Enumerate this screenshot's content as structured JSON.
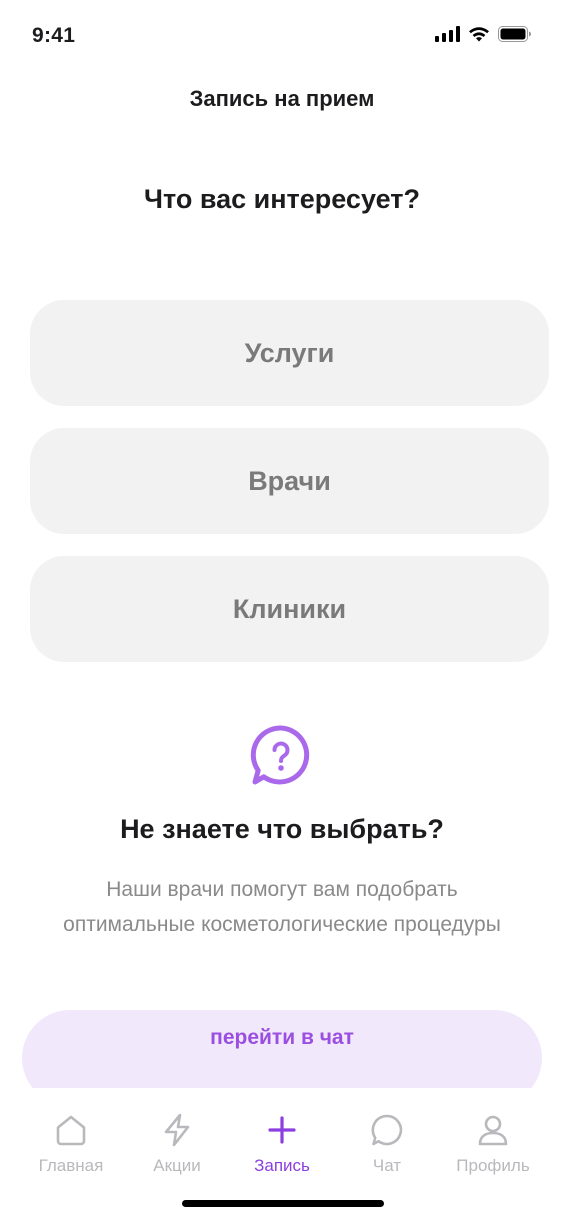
{
  "status_bar": {
    "time": "9:41"
  },
  "header": {
    "title": "Запись на прием"
  },
  "main": {
    "question": "Что вас интересует?",
    "options": [
      {
        "label": "Услуги"
      },
      {
        "label": "Врачи"
      },
      {
        "label": "Клиники"
      }
    ]
  },
  "help": {
    "icon": "question-chat-icon",
    "title": "Не знаете что выбрать?",
    "text": "Наши врачи помогут вам подобрать оптимальные косметологические процедуры",
    "button_label": "перейти в чат"
  },
  "tab_bar": {
    "items": [
      {
        "label": "Главная",
        "icon": "home-icon",
        "active": false
      },
      {
        "label": "Акции",
        "icon": "lightning-icon",
        "active": false
      },
      {
        "label": "Запись",
        "icon": "plus-icon",
        "active": true
      },
      {
        "label": "Чат",
        "icon": "chat-bubble-icon",
        "active": false
      },
      {
        "label": "Профиль",
        "icon": "profile-icon",
        "active": false
      }
    ]
  },
  "colors": {
    "accent": "#8b3fe0",
    "accent_light": "#f1e8fb",
    "option_bg": "#f2f2f2",
    "inactive_icon": "#b9b9bd"
  }
}
